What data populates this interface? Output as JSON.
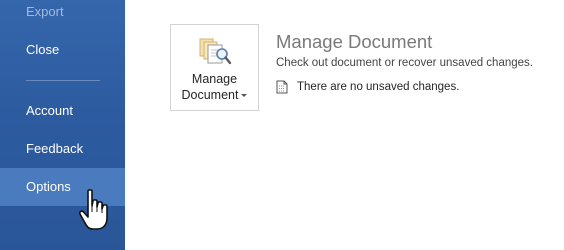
{
  "sidebar": {
    "items": [
      {
        "label": "Export",
        "state": "partially-visible"
      },
      {
        "label": "Close"
      },
      {
        "label": "Account"
      },
      {
        "label": "Feedback"
      },
      {
        "label": "Options",
        "state": "hover"
      }
    ]
  },
  "manage": {
    "button_line1": "Manage",
    "button_line2": "Document",
    "title": "Manage Document",
    "description": "Check out document or recover unsaved changes.",
    "status": "There are no unsaved changes."
  },
  "icons": {
    "manage": "manage-document-icon",
    "status": "document-icon",
    "cursor": "hand-pointer-icon"
  },
  "colors": {
    "sidebar": "#2d5ba0",
    "sidebar_hover": "#4a7bbf",
    "title": "#7a7a7a"
  }
}
